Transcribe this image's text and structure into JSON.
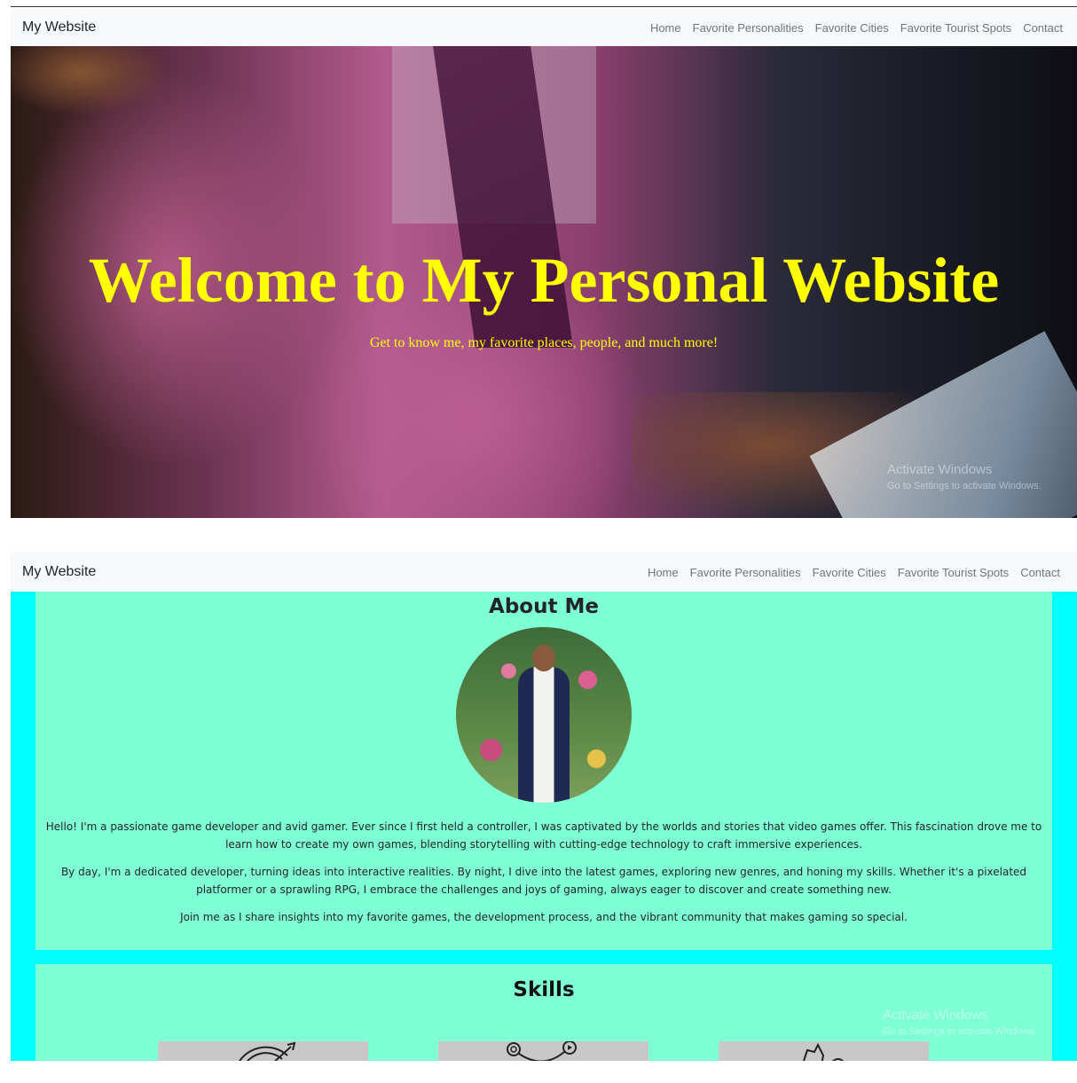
{
  "nav": {
    "brand": "My Website",
    "links": [
      "Home",
      "Favorite Personalities",
      "Favorite Cities",
      "Favorite Tourist Spots",
      "Contact"
    ]
  },
  "hero": {
    "title": "Welcome to My Personal Website",
    "subtitle": "Get to know me, my favorite places, people, and much more!"
  },
  "about": {
    "title": "About Me",
    "paragraphs": [
      "Hello! I'm a passionate game developer and avid gamer. Ever since I first held a controller, I was captivated by the worlds and stories that video games offer. This fascination drove me to learn how to create my own games, blending storytelling with cutting-edge technology to craft immersive experiences.",
      "By day, I'm a dedicated developer, turning ideas into interactive realities. By night, I dive into the latest games, exploring new genres, and honing my skills. Whether it's a pixelated platformer or a sprawling RPG, I embrace the challenges and joys of gaming, always eager to discover and create something new.",
      "Join me as I share insights into my favorite games, the development process, and the vibrant community that makes gaming so special."
    ]
  },
  "skills": {
    "title": "Skills",
    "icons": [
      "target-arrow-icon",
      "game-controller-network-icon",
      "strategy-icon"
    ]
  },
  "watermark": {
    "line1": "Activate Windows",
    "line2": "Go to Settings to activate Windows."
  },
  "colors": {
    "hero_text": "#ffff00",
    "section_bg": "#00ffff",
    "panel_bg": "#7fffd4",
    "navbar_bg": "#f8f9fa"
  }
}
